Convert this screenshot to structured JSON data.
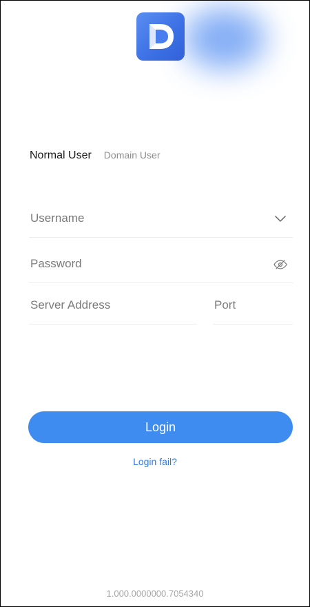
{
  "app": {
    "logo_icon": "app-logo-d-icon",
    "accent_color": "#3f8cf0"
  },
  "tabs": {
    "normal_user": "Normal User",
    "domain_user": "Domain User"
  },
  "form": {
    "username_placeholder": "Username",
    "username_icon": "chevron-down-icon",
    "password_placeholder": "Password",
    "password_icon": "eye-off-icon",
    "server_placeholder": "Server Address",
    "port_placeholder": "Port"
  },
  "actions": {
    "login_label": "Login",
    "login_fail_label": "Login fail?"
  },
  "footer": {
    "version": "1.000.0000000.7054340"
  }
}
